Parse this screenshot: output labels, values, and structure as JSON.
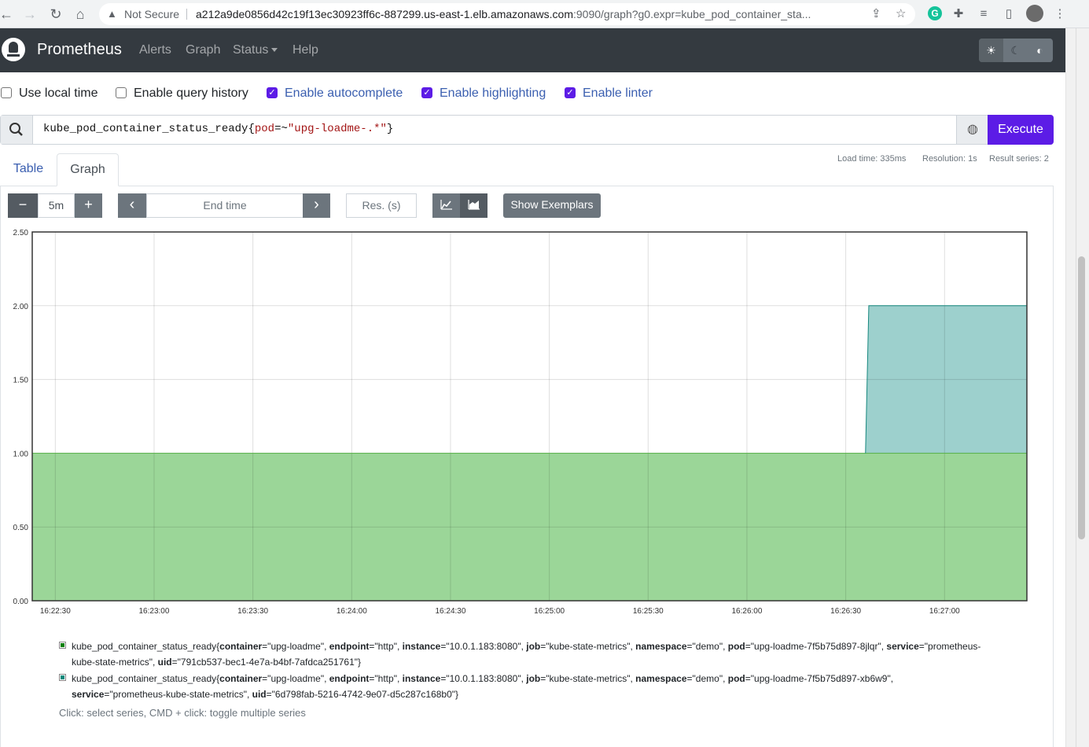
{
  "browser": {
    "security_label": "Not Secure",
    "url_host": "a212a9de0856d42c19f13ec30923ff6c-887299.us-east-1.elb.amazonaws.com",
    "url_rest": ":9090/graph?g0.expr=kube_pod_container_sta..."
  },
  "navbar": {
    "brand": "Prometheus",
    "links": [
      "Alerts",
      "Graph",
      "Status",
      "Help"
    ]
  },
  "options": [
    {
      "label": "Use local time",
      "checked": false
    },
    {
      "label": "Enable query history",
      "checked": false
    },
    {
      "label": "Enable autocomplete",
      "checked": true
    },
    {
      "label": "Enable highlighting",
      "checked": true
    },
    {
      "label": "Enable linter",
      "checked": true
    }
  ],
  "query": {
    "metric": "kube_pod_container_status_ready",
    "open": "{",
    "label": "pod",
    "op": "=~",
    "value": "\"upg-loadme-.*\"",
    "close": "}",
    "execute_label": "Execute"
  },
  "tabs": {
    "table": "Table",
    "graph": "Graph",
    "active": "Graph"
  },
  "stats": {
    "load_time": "Load time: 335ms",
    "resolution": "Resolution: 1s",
    "result_series": "Result series: 2"
  },
  "controls": {
    "range": "5m",
    "end_time_placeholder": "End time",
    "res_placeholder": "Res. (s)",
    "show_exemplars": "Show Exemplars",
    "minus_glyph": "−",
    "plus_glyph": "+",
    "prev_glyph": "‹",
    "next_glyph": "›"
  },
  "chart_data": {
    "type": "area",
    "stacked": true,
    "y_ticks": [
      "0.00",
      "0.50",
      "1.00",
      "1.50",
      "2.00",
      "2.50"
    ],
    "ylim": [
      0,
      2.5
    ],
    "x_ticks": [
      "16:22:30",
      "16:23:00",
      "16:23:30",
      "16:24:00",
      "16:24:30",
      "16:25:00",
      "16:25:30",
      "16:26:00",
      "16:26:30",
      "16:27:00"
    ],
    "x_range": [
      "16:22:23",
      "16:27:25"
    ],
    "grid": true,
    "series": [
      {
        "color": "#5ab54b",
        "fill": "#9bd698",
        "points": [
          [
            "16:22:23",
            1
          ],
          [
            "16:27:25",
            1
          ]
        ]
      },
      {
        "color": "#17887f",
        "fill": "#9dd0cd",
        "points": [
          [
            "16:26:36",
            0
          ],
          [
            "16:26:37",
            1
          ],
          [
            "16:27:25",
            1
          ]
        ]
      }
    ]
  },
  "legend": [
    {
      "color": "#008000",
      "metric": "kube_pod_container_status_ready",
      "labels": [
        {
          "k": "container",
          "v": "\"upg-loadme\""
        },
        {
          "k": "endpoint",
          "v": "\"http\""
        },
        {
          "k": "instance",
          "v": "\"10.0.1.183:8080\""
        },
        {
          "k": "job",
          "v": "\"kube-state-metrics\""
        },
        {
          "k": "namespace",
          "v": "\"demo\""
        },
        {
          "k": "pod",
          "v": "\"upg-loadme-7f5b75d897-8jlqr\""
        },
        {
          "k": "service",
          "v": "\"prometheus-kube-state-metrics\""
        },
        {
          "k": "uid",
          "v": "\"791cb537-bec1-4e7a-b4bf-7afdca251761\""
        }
      ]
    },
    {
      "color": "#00897b",
      "metric": "kube_pod_container_status_ready",
      "labels": [
        {
          "k": "container",
          "v": "\"upg-loadme\""
        },
        {
          "k": "endpoint",
          "v": "\"http\""
        },
        {
          "k": "instance",
          "v": "\"10.0.1.183:8080\""
        },
        {
          "k": "job",
          "v": "\"kube-state-metrics\""
        },
        {
          "k": "namespace",
          "v": "\"demo\""
        },
        {
          "k": "pod",
          "v": "\"upg-loadme-7f5b75d897-xb6w9\""
        },
        {
          "k": "service",
          "v": "\"prometheus-kube-state-metrics\""
        },
        {
          "k": "uid",
          "v": "\"6d798fab-5216-4742-9e07-d5c287c168b0\""
        }
      ]
    }
  ],
  "hint": "Click: select series, CMD + click: toggle multiple series"
}
